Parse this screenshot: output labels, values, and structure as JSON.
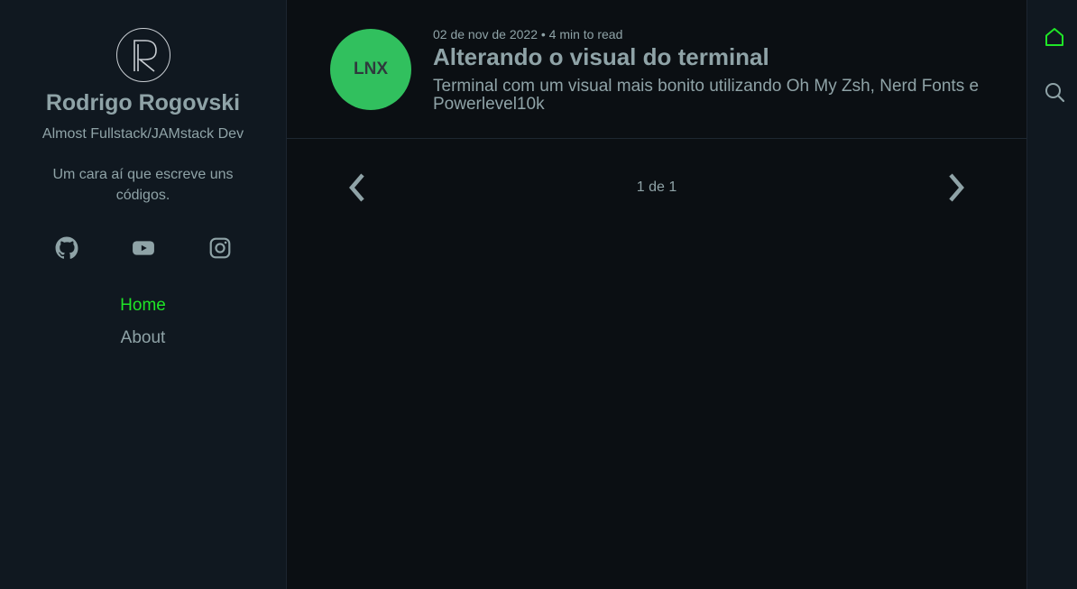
{
  "sidebar": {
    "author_name": "Rodrigo Rogovski",
    "author_position": "Almost Fullstack/JAMstack Dev",
    "author_description": "Um cara aí que escreve uns códigos.",
    "social": [
      {
        "icon": "github-icon"
      },
      {
        "icon": "youtube-icon"
      },
      {
        "icon": "instagram-icon"
      }
    ],
    "menu": [
      {
        "label": "Home",
        "active": true
      },
      {
        "label": "About",
        "active": false
      }
    ]
  },
  "posts": [
    {
      "tag": "LNX",
      "tag_color": "#31c05e",
      "date": "02 de nov de 2022 • 4 min to read",
      "title": "Alterando o visual do terminal",
      "description": "Terminal com um visual mais bonito utilizando Oh My Zsh, Nerd Fonts e Powerlevel10k"
    }
  ],
  "pagination": {
    "label": "1 de 1"
  },
  "rightbar": {
    "icons": [
      "home-icon",
      "search-icon"
    ]
  },
  "colors": {
    "accent": "#1fe627",
    "text": "#8fa3a7",
    "background": "#0b0f13",
    "sidebar": "#101820"
  }
}
